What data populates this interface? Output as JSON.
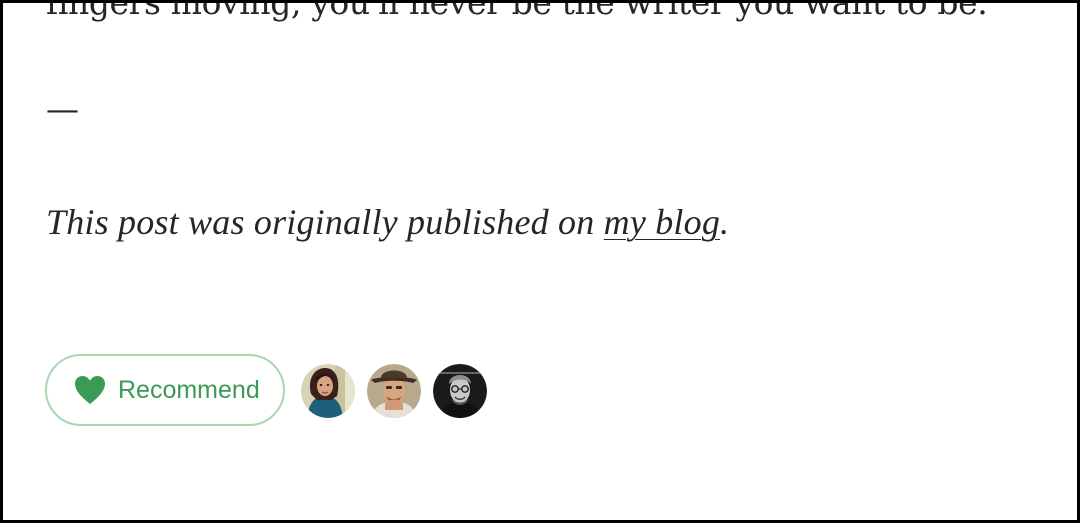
{
  "article": {
    "cut_line": "fingers moving, you'll never be the writer you want to be.",
    "separator": "—",
    "footer_prefix": "This post was originally published on ",
    "footer_link": "my blog",
    "footer_suffix": "."
  },
  "actions": {
    "recommend_label": "Recommend"
  },
  "recommenders": [
    {
      "name": "recommender-avatar-1"
    },
    {
      "name": "recommender-avatar-2"
    },
    {
      "name": "recommender-avatar-3"
    }
  ],
  "colors": {
    "accent": "#3b9a54",
    "button_border": "#a7d8b1",
    "text": "#262626"
  }
}
